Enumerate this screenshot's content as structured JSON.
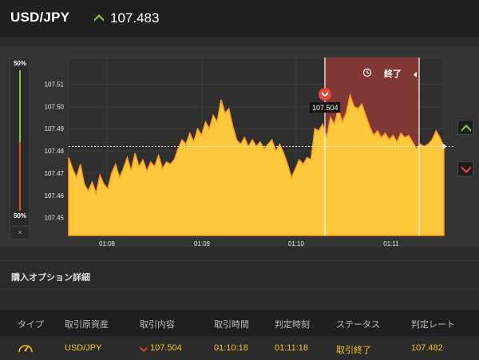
{
  "header": {
    "pair": "USD/JPY",
    "price": "107.483",
    "direction": "up"
  },
  "ratio": {
    "high": "50%",
    "low": "50%",
    "close": "×"
  },
  "chart_data": {
    "type": "area",
    "y_ticks": [
      "107.51",
      "107.50",
      "107.49",
      "107.48",
      "107.47",
      "107.46",
      "107.45"
    ],
    "ylim": [
      107.442,
      107.522
    ],
    "x_ticks": [
      "01:08",
      "01:09",
      "01:10",
      "01:11"
    ],
    "current_rate": 107.482,
    "entry_label": "107.504",
    "entry_rate": 107.504,
    "window_label": "終了",
    "values": [
      107.477,
      107.472,
      107.468,
      107.474,
      107.465,
      107.462,
      107.466,
      107.461,
      107.469,
      107.465,
      107.463,
      107.47,
      107.474,
      107.468,
      107.472,
      107.477,
      107.471,
      107.479,
      107.473,
      107.476,
      107.471,
      107.475,
      107.473,
      107.478,
      107.472,
      107.475,
      107.474,
      107.476,
      107.481,
      107.485,
      107.483,
      107.488,
      107.484,
      107.49,
      107.487,
      107.493,
      107.49,
      107.496,
      107.493,
      107.503,
      107.497,
      107.499,
      107.491,
      107.485,
      107.483,
      107.486,
      107.482,
      107.485,
      107.482,
      107.484,
      107.481,
      107.483,
      107.485,
      107.48,
      107.483,
      107.479,
      107.474,
      107.468,
      107.472,
      107.476,
      107.474,
      107.477,
      107.476,
      107.49,
      107.489,
      107.492,
      107.486,
      107.495,
      107.492,
      107.499,
      107.493,
      107.497,
      107.505,
      107.5,
      107.499,
      107.501,
      107.496,
      107.491,
      107.487,
      107.489,
      107.486,
      107.488,
      107.485,
      107.487,
      107.484,
      107.488,
      107.486,
      107.487,
      107.484,
      107.481,
      107.483,
      107.482,
      107.483,
      107.485,
      107.489,
      107.486,
      107.482
    ],
    "colors": {
      "fill": "#ffc83d",
      "line": "#ff9a1f",
      "window": "#8a3a36",
      "entry": "#e2463f"
    }
  },
  "details": {
    "title": "購入オプション詳細",
    "headers": [
      "タイプ",
      "取引原資産",
      "取引内容",
      "取引時間",
      "判定時刻",
      "ステータス",
      "判定レート"
    ],
    "row": {
      "asset": "USD/JPY",
      "content": "107.504",
      "trade_time": "01:10:18",
      "judge_time": "01:11:18",
      "status": "取引終了",
      "rate": "107.482"
    }
  }
}
